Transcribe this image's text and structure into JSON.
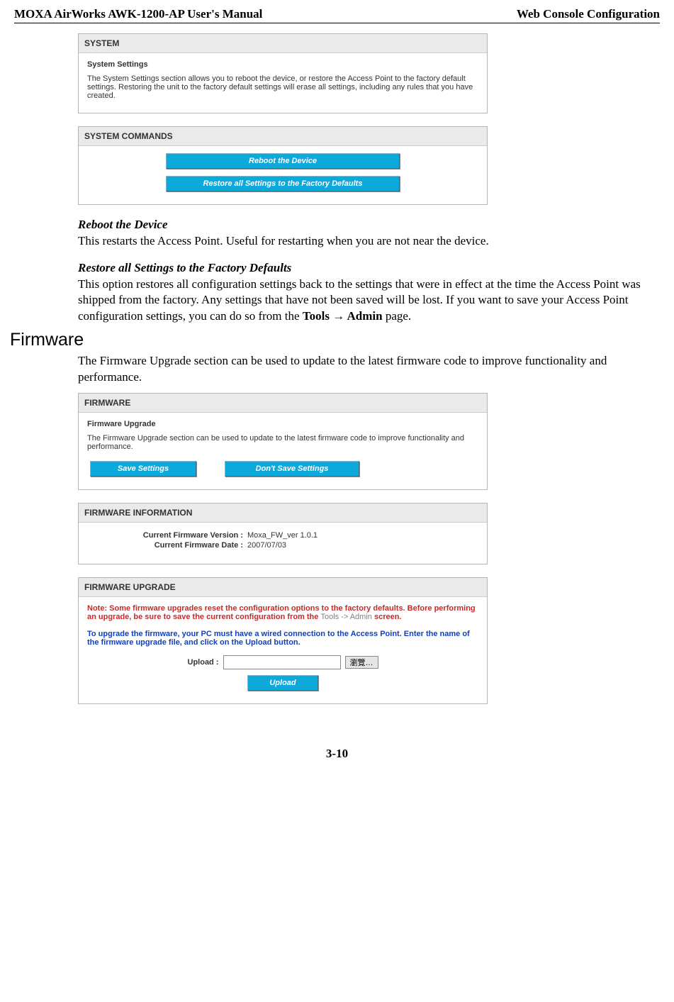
{
  "header": {
    "left": "MOXA AirWorks AWK-1200-AP User's Manual",
    "right": "Web Console Configuration"
  },
  "system_panel": {
    "title": "SYSTEM",
    "sub": "System Settings",
    "text": "The System Settings section allows you to reboot the device, or restore the Access Point to the factory default settings. Restoring the unit to the factory default settings will erase all settings, including any rules that you have created."
  },
  "commands_panel": {
    "title": "SYSTEM COMMANDS",
    "btn_reboot": "Reboot the Device",
    "btn_restore": "Restore all Settings to the Factory Defaults"
  },
  "body1": {
    "h1": "Reboot the Device",
    "p1": "This restarts the Access Point. Useful for restarting when you are not near the device.",
    "h2": "Restore all Settings to the Factory Defaults",
    "p2a": "This option restores all configuration settings back to the settings that were in effect at the time the Access Point was shipped from the factory. Any settings that have not been saved will be lost. If you want to save your Access Point configuration settings, you can do so from the ",
    "p2b": "Tools ",
    "p2arrow": "→",
    "p2c": " Admin",
    "p2d": " page."
  },
  "section_h2": "Firmware",
  "body2": {
    "p": "The Firmware Upgrade section can be used to update to the latest firmware code to improve functionality and performance."
  },
  "fw_panel": {
    "title": "FIRMWARE",
    "sub": "Firmware Upgrade",
    "text": "The Firmware Upgrade section can be used to update to the latest firmware code to improve functionality and performance.",
    "btn_save": "Save Settings",
    "btn_dont": "Don't Save Settings"
  },
  "fw_info_panel": {
    "title": "FIRMWARE INFORMATION",
    "row1_label": "Current Firmware Version :",
    "row1_val": "Moxa_FW_ver  1.0.1",
    "row2_label": "Current Firmware Date :",
    "row2_val": "2007/07/03"
  },
  "fw_upgrade_panel": {
    "title": "FIRMWARE UPGRADE",
    "note1a": "Note: Some firmware upgrades reset the configuration options to the factory defaults. Before performing an upgrade, be sure to save the current configuration from the ",
    "note1b": "Tools -> Admin",
    "note1c": " screen.",
    "note2": "To upgrade the firmware, your PC must have a wired connection to the Access Point. Enter the name of the firmware upgrade file, and click on the Upload button.",
    "upload_label": "Upload :",
    "browse_label": "瀏覽…",
    "btn_upload": "Upload"
  },
  "footer": "3-10"
}
